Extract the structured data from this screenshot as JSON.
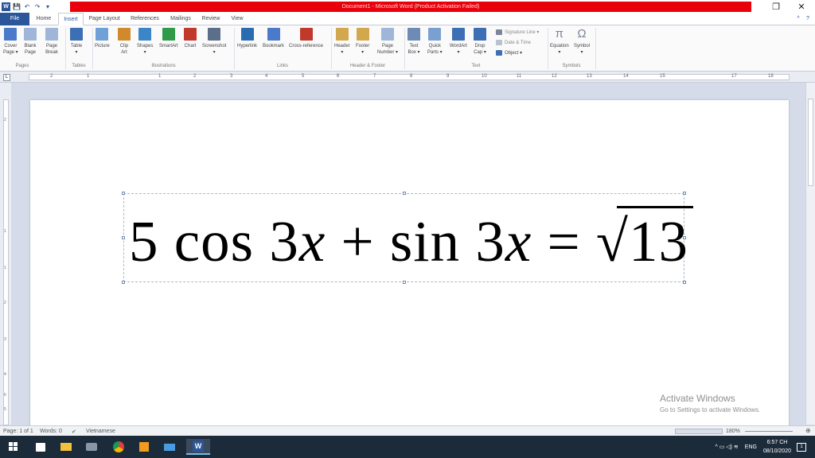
{
  "window": {
    "title": "Document1 - Microsoft Word (Product Activation Failed)",
    "controls": {
      "restore": "❐",
      "close": "✕"
    }
  },
  "qat": {
    "logo": "W",
    "save": "💾",
    "undo": "↶",
    "redo": "↷",
    "customize": "▾"
  },
  "tabs": [
    "File",
    "Home",
    "Insert",
    "Page Layout",
    "References",
    "Mailings",
    "Review",
    "View"
  ],
  "active_tab": "Insert",
  "ribbon": {
    "buttons": [
      {
        "label": "Cover\nPage ▾",
        "icon": "cover-page-icon",
        "color": "#4a7ac9"
      },
      {
        "label": "Blank\nPage",
        "icon": "blank-page-icon",
        "color": "#9fb6d8"
      },
      {
        "label": "Page\nBreak",
        "icon": "page-break-icon",
        "color": "#9fb6d8"
      },
      {
        "label": "Table\n▾",
        "icon": "table-icon",
        "color": "#3c6fb4"
      },
      {
        "label": "Picture",
        "icon": "picture-icon",
        "color": "#6fa0d8"
      },
      {
        "label": "Clip\nArt",
        "icon": "clip-art-icon",
        "color": "#d08a2c"
      },
      {
        "label": "Shapes\n▾",
        "icon": "shapes-icon",
        "color": "#3a86c8"
      },
      {
        "label": "SmartArt",
        "icon": "smartart-icon",
        "color": "#2f9a4a"
      },
      {
        "label": "Chart",
        "icon": "chart-icon",
        "color": "#c0392b"
      },
      {
        "label": "Screenshot\n▾",
        "icon": "screenshot-icon",
        "color": "#5c6f8a"
      },
      {
        "label": "Hyperlink",
        "icon": "hyperlink-icon",
        "color": "#2b6cb0"
      },
      {
        "label": "Bookmark",
        "icon": "bookmark-icon",
        "color": "#4a7ac9"
      },
      {
        "label": "Cross-reference",
        "icon": "cross-reference-icon",
        "color": "#c0392b"
      },
      {
        "label": "Header\n▾",
        "icon": "header-icon",
        "color": "#d3a74e"
      },
      {
        "label": "Footer\n▾",
        "icon": "footer-icon",
        "color": "#d3a74e"
      },
      {
        "label": "Page\nNumber ▾",
        "icon": "page-number-icon",
        "color": "#9fb6d8"
      },
      {
        "label": "Text\nBox ▾",
        "icon": "text-box-icon",
        "color": "#6f8bb5"
      },
      {
        "label": "Quick\nParts ▾",
        "icon": "quick-parts-icon",
        "color": "#7aa0cf"
      },
      {
        "label": "WordArt\n▾",
        "icon": "wordart-icon",
        "color": "#3c6fb4"
      },
      {
        "label": "Drop\nCap ▾",
        "icon": "drop-cap-icon",
        "color": "#3c6fb4"
      },
      {
        "label": "Equation\n▾",
        "icon": "equation-icon",
        "color": "#7a8699"
      },
      {
        "label": "Symbol\n▾",
        "icon": "symbol-icon",
        "color": "#7a8699"
      }
    ],
    "small": {
      "signature_line": "Signature Line ▾",
      "date_time": "Date & Time",
      "object": "Object ▾"
    },
    "glyphs": {
      "pi": "π",
      "omega": "Ω"
    },
    "groups": [
      "Pages",
      "Tables",
      "Illustrations",
      "Links",
      "Header & Footer",
      "Text",
      "Symbols"
    ]
  },
  "ruler": {
    "h_numbers": [
      "2",
      "1",
      "1",
      "2",
      "3",
      "4",
      "5",
      "6",
      "7",
      "8",
      "9",
      "10",
      "11",
      "12",
      "13",
      "14",
      "15",
      "17",
      "18"
    ],
    "v_numbers": [
      "2",
      "1",
      "1",
      "2",
      "3",
      "4",
      "5",
      "6"
    ]
  },
  "equation": {
    "coef": "5",
    "fn1": "cos",
    "arg1": "3",
    "var1": "x",
    "plus": "+",
    "fn2": "sin",
    "arg2": "3",
    "var2": "x",
    "eq": "=",
    "root": "√",
    "radicand": "13"
  },
  "watermark": {
    "title": "Activate Windows",
    "subtitle": "Go to Settings to activate Windows."
  },
  "status": {
    "page": "Page: 1 of 1",
    "words": "Words: 0",
    "language": "Vietnamese",
    "zoom": "180%"
  },
  "tray": {
    "language": "ENG",
    "time": "6:57 CH",
    "date": "08/10/2020",
    "notifications": "1"
  }
}
